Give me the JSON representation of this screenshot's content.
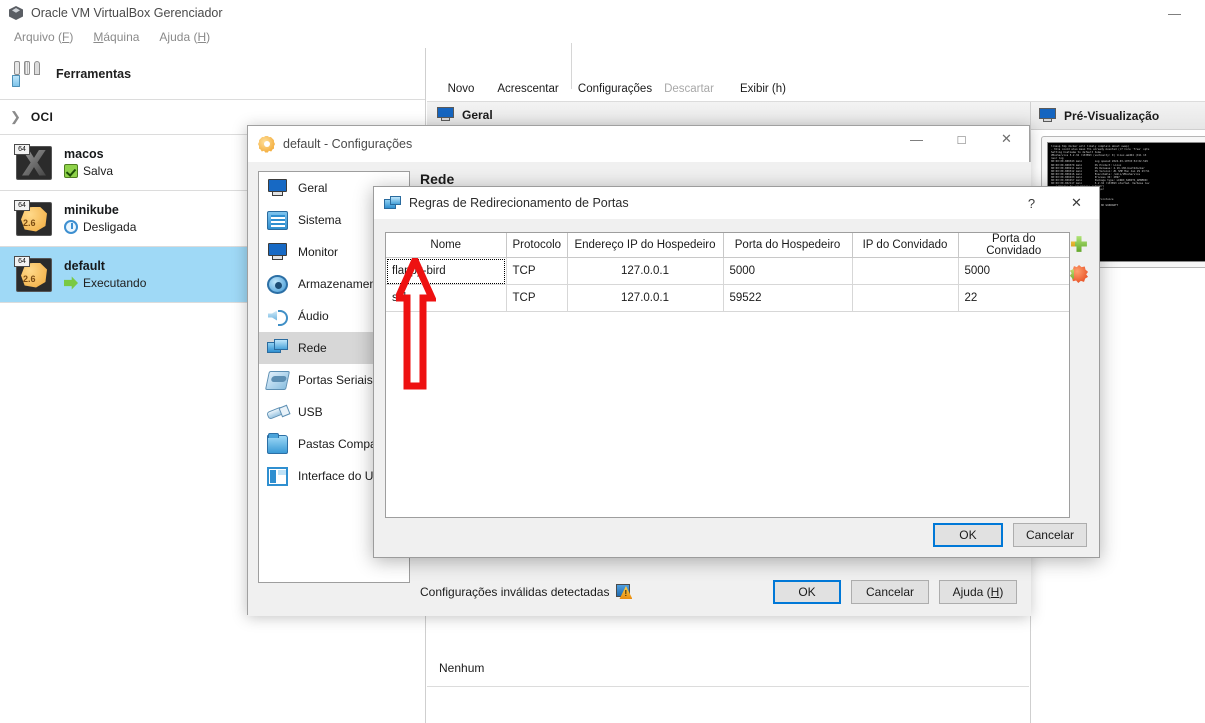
{
  "main_window": {
    "title": "Oracle VM VirtualBox Gerenciador",
    "logo_icon": "virtualbox-logo-icon",
    "minimize_label": "—",
    "menus": [
      {
        "label": "Arquivo (F)",
        "text": "Arquivo",
        "accel": "F"
      },
      {
        "label": "Máquina",
        "text": "Máquina",
        "accel": "M"
      },
      {
        "label": "Ajuda (H)",
        "text": "Ajuda",
        "accel": "H"
      }
    ],
    "tools_label": "Ferramentas",
    "oci_label": "OCI",
    "vm_list": [
      {
        "name": "macos",
        "state": "Salva",
        "badge": "64",
        "version": "",
        "os_kind": "macos",
        "state_kind": "saved",
        "selected": false
      },
      {
        "name": "minikube",
        "state": "Desligada",
        "badge": "64",
        "version": "2.6",
        "os_kind": "linux",
        "state_kind": "off",
        "selected": false
      },
      {
        "name": "default",
        "state": "Executando",
        "badge": "64",
        "version": "2.6",
        "os_kind": "linux",
        "state_kind": "running",
        "selected": true
      }
    ],
    "toolbar": [
      {
        "label": "Novo",
        "icon": "new-star-icon",
        "disabled": false
      },
      {
        "label": "Acrescentar",
        "icon": "add-plus-icon",
        "disabled": false
      },
      {
        "label": "Configurações",
        "icon": "settings-gear-icon",
        "disabled": false
      },
      {
        "label": "Descartar",
        "icon": "discard-down-arrow-icon",
        "disabled": true
      },
      {
        "label": "Exibir (h)",
        "icon": "show-right-arrow-icon",
        "disabled": false
      }
    ],
    "geral_tab_label": "Geral",
    "detail_none_label": "Nenhum",
    "preview": {
      "header": "Pré-Visualização",
      "terminal_text": "lineup tmp docker will likely complain about swap)\n- this could also mean TCL already mounted (if Core 'free' opts\nSetting hostname to default home\nVBoxService 5.2.34 r133893 (verbosity: 0) linux.amd64 (X11 13\nnsor log\n00:00:00.000343 main        Log opened 2024-03-19T15:52:02.529\n00:00:00.000370 main        OS Product: Linux\n00:00:00.000211 main        OS Release: 4.19.130-boot2docker\n00:00:00.000312 main        OS Version: #1 SMP Mon Jan 29 23:51\n00:00:00.000416 main        Executable: /sbin/VBoxService\n00:00:00.000433 main        Process ID: 2897\n00:00:00.000457 main        Package type: LINUX_64BITS_GENERIC\n00:00:00.002117 main        5.2.34 r133893 started. Verbose lev\n...s/share' to '/s/share' (shmnt?)\n...th notified and the input layer\n\n...ests: event logging is off\n... /var/lib/boot2docker for persistence\n\n... distributed with ABSOLUTELY NO WARRANTY\n    www.tinycorelinux.net"
    }
  },
  "settings_dialog": {
    "title": "default - Configurações",
    "icon": "settings-gear-icon",
    "window_buttons": {
      "minimize": "—",
      "maximize": "□",
      "close": "✕"
    },
    "nav_items": [
      {
        "label": "Geral",
        "icon": "display-icon",
        "active": false
      },
      {
        "label": "Sistema",
        "icon": "system-chip-icon",
        "active": false
      },
      {
        "label": "Monitor",
        "icon": "monitor-icon",
        "active": false
      },
      {
        "label": "Armazenamento",
        "icon": "storage-disk-icon",
        "active": false
      },
      {
        "label": "Áudio",
        "icon": "audio-speaker-icon",
        "active": false
      },
      {
        "label": "Rede",
        "icon": "network-icon",
        "active": true
      },
      {
        "label": "Portas Seriais",
        "icon": "serial-ports-icon",
        "active": false
      },
      {
        "label": "USB",
        "icon": "usb-icon",
        "active": false
      },
      {
        "label": "Pastas Compartil",
        "icon": "shared-folders-icon",
        "active": false
      },
      {
        "label": "Interface do Usu",
        "icon": "user-interface-icon",
        "active": false
      }
    ],
    "page_heading": "Rede",
    "invalid_settings_message": "Configurações inválidas detectadas",
    "invalid_settings_icon": "warning-icon",
    "buttons": [
      {
        "label": "OK",
        "default": true
      },
      {
        "label": "Cancelar",
        "default": false
      },
      {
        "label": "Ajuda (H)",
        "text": "Ajuda",
        "accel": "H",
        "default": false
      }
    ]
  },
  "port_forwarding_dialog": {
    "title": "Regras de Redirecionamento de Portas",
    "icon": "network-icon",
    "help_button": "?",
    "close_button": "✕",
    "table": {
      "columns": [
        "Nome",
        "Protocolo",
        "Endereço IP do Hospedeiro",
        "Porta do Hospedeiro",
        "IP do Convidado",
        "Porta do Convidado"
      ],
      "rows": [
        {
          "cells": [
            "flappy-bird",
            "TCP",
            "127.0.0.1",
            "5000",
            "",
            "5000"
          ],
          "focused_cell": 0
        },
        {
          "cells": [
            "ssh",
            "TCP",
            "127.0.0.1",
            "59522",
            "",
            "22"
          ],
          "focused_cell": -1
        }
      ]
    },
    "side_buttons": [
      {
        "icon": "add-rule-icon",
        "label": "Adicionar regra"
      },
      {
        "icon": "remove-rule-icon",
        "label": "Remover regra"
      }
    ],
    "buttons": [
      {
        "label": "OK",
        "default": true
      },
      {
        "label": "Cancelar",
        "default": false
      }
    ]
  },
  "annotation": {
    "arrow_color": "#ee1111",
    "target": "flappy-bird name cell"
  }
}
